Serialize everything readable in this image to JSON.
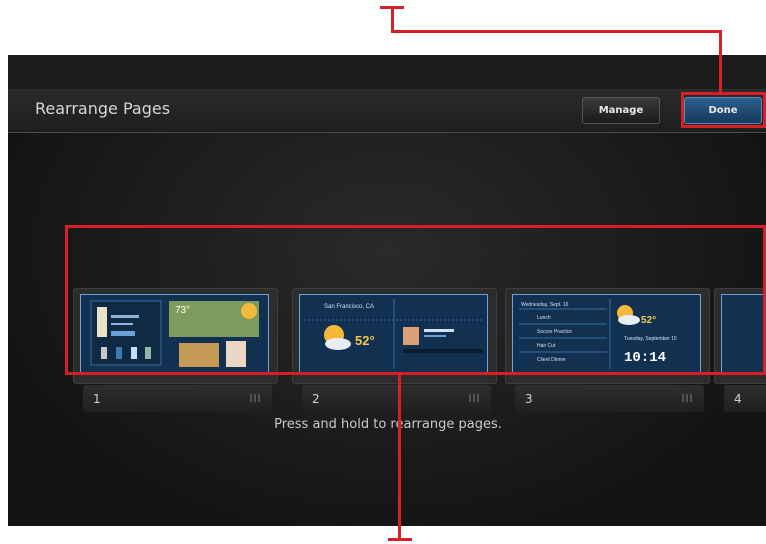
{
  "header": {
    "title": "Rearrange Pages",
    "manage_label": "Manage",
    "done_label": "Done"
  },
  "pages": [
    {
      "number": "1"
    },
    {
      "number": "2"
    },
    {
      "number": "3"
    },
    {
      "number": "4"
    }
  ],
  "thumb_text": {
    "p1_temp": "73°",
    "p2_city": "San Francisco, CA",
    "p2_temp": "52°",
    "p3_day": "Wednesday, Sept. 16",
    "p3_items": [
      "Lunch",
      "Soccer Practice",
      "Hair Cut",
      "Client Dinner"
    ],
    "p3_temp": "52°",
    "p3_date": "Tuesday, September 15",
    "p3_time": "10:14"
  },
  "hint_text": "Press and hold to rearrange pages.",
  "colors": {
    "callout": "#d61f26",
    "accent": "#2b5f8e"
  }
}
